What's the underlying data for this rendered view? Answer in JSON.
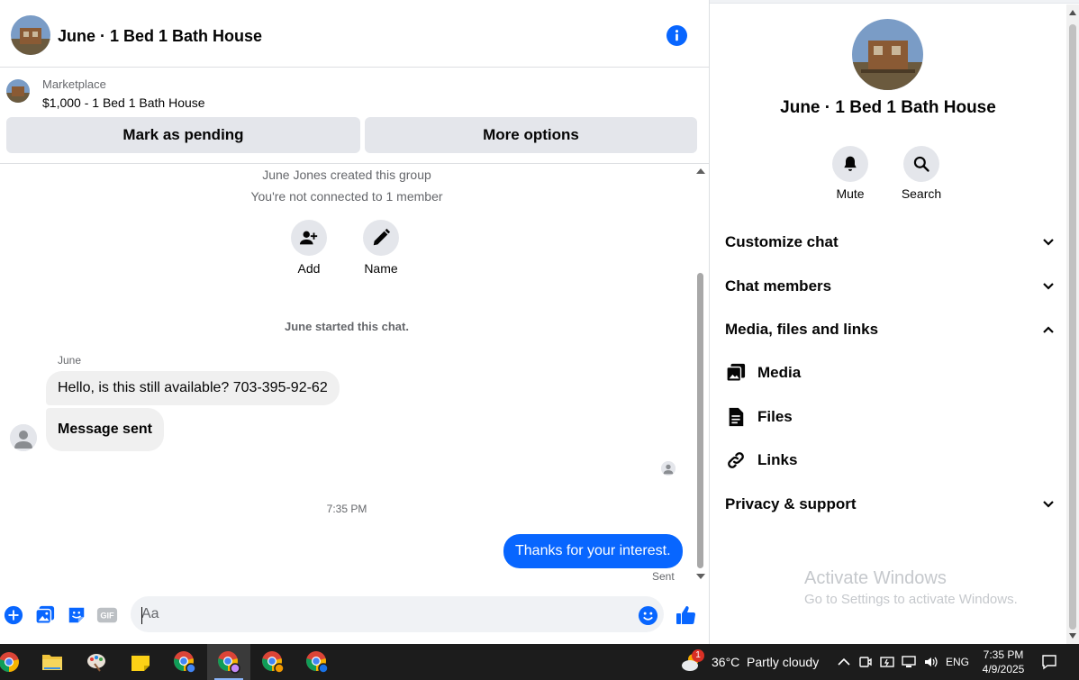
{
  "chat": {
    "title": "June · 1 Bed 1 Bath House",
    "listing": {
      "source": "Marketplace",
      "price_title": "$1,000 - 1 Bed 1 Bath House",
      "mark_pending_label": "Mark as pending",
      "more_options_label": "More options"
    },
    "system": {
      "created": "June Jones created this group",
      "not_connected": "You're not connected to 1 member",
      "started": "June started this chat."
    },
    "actions": {
      "add_label": "Add",
      "name_label": "Name"
    },
    "messages": {
      "sender": "June",
      "incoming_1": "Hello, is this still available? 703-395-92-62",
      "incoming_2": "Message sent",
      "timestamp": "7:35 PM",
      "outgoing_1": "Thanks for your interest.",
      "outgoing_status": "Sent"
    },
    "composer": {
      "placeholder": "Aa"
    }
  },
  "info": {
    "title": "June · 1 Bed 1 Bath House",
    "mute_label": "Mute",
    "search_label": "Search",
    "sections": {
      "customize": "Customize chat",
      "members": "Chat members",
      "media_files_links": "Media, files and links",
      "media": "Media",
      "files": "Files",
      "links": "Links",
      "privacy": "Privacy & support"
    },
    "activate": {
      "title": "Activate Windows",
      "subtitle": "Go to Settings to activate Windows."
    }
  },
  "taskbar": {
    "weather": "36°C  Partly cloudy",
    "lang": "ENG",
    "time": "7:35 PM",
    "date": "4/9/2025",
    "badge": "1"
  },
  "colors": {
    "accent": "#0866ff",
    "bubble_in": "#f0f0f0",
    "button_gray": "#e4e6eb",
    "taskbar": "#1c1c1c"
  }
}
